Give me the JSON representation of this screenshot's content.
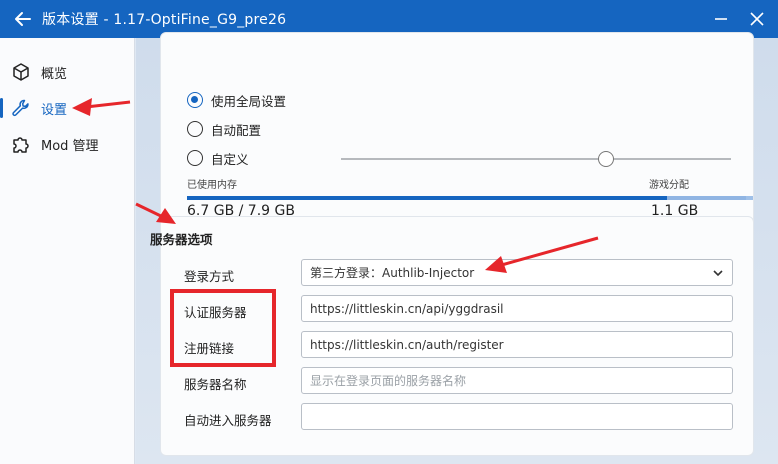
{
  "window": {
    "title": "版本设置 - 1.17-OptiFine_G9_pre26"
  },
  "sidebar": {
    "items": [
      {
        "label": "概览",
        "icon": "cube-icon"
      },
      {
        "label": "设置",
        "icon": "wrench-icon",
        "active": true
      },
      {
        "label": "Mod 管理",
        "icon": "puzzle-icon"
      }
    ]
  },
  "memory": {
    "options": [
      {
        "label": "使用全局设置",
        "checked": true
      },
      {
        "label": "自动配置",
        "checked": false
      },
      {
        "label": "自定义",
        "checked": false
      }
    ],
    "slider_fraction": 0.68,
    "used_label": "已使用内存",
    "alloc_label": "游戏分配",
    "used_value": "6.7 GB / 7.9 GB",
    "alloc_value": "1.1 GB",
    "used_fraction": 0.848,
    "alloc_fraction": 0.139
  },
  "server": {
    "section_title": "服务器选项",
    "login_label": "登录方式",
    "login_value": "第三方登录：Authlib-Injector",
    "auth_label": "认证服务器",
    "auth_value": "https://littleskin.cn/api/yggdrasil",
    "register_label": "注册链接",
    "register_value": "https://littleskin.cn/auth/register",
    "name_label": "服务器名称",
    "name_placeholder": "显示在登录页面的服务器名称",
    "autojoin_label": "自动进入服务器",
    "autojoin_value": ""
  },
  "colors": {
    "accent": "#1565c0",
    "annotation": "#e6262b"
  }
}
